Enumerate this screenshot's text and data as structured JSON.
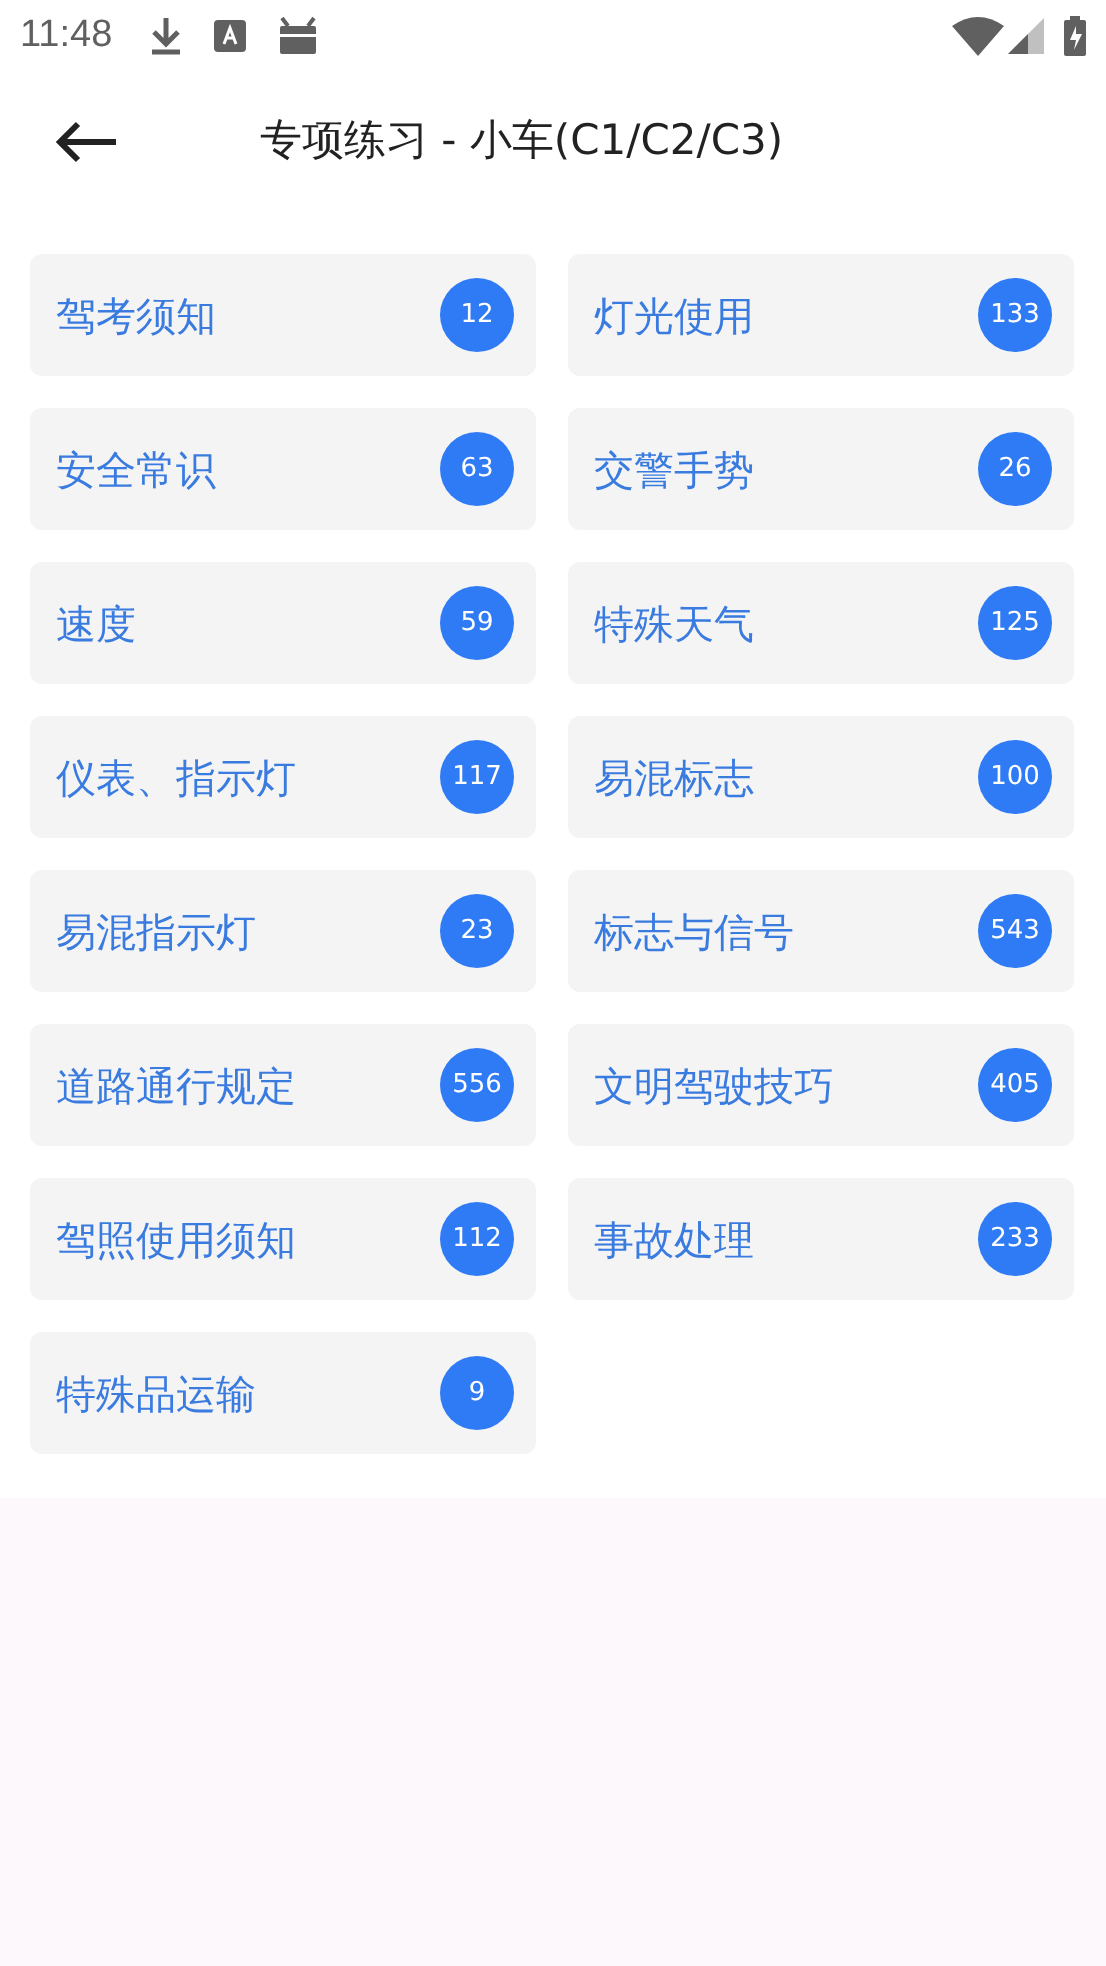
{
  "status_bar": {
    "time": "11:48"
  },
  "header": {
    "title": "专项练习 - 小车(C1/C2/C3)"
  },
  "categories": [
    {
      "label": "驾考须知",
      "count": "12"
    },
    {
      "label": "灯光使用",
      "count": "133"
    },
    {
      "label": "安全常识",
      "count": "63"
    },
    {
      "label": "交警手势",
      "count": "26"
    },
    {
      "label": "速度",
      "count": "59"
    },
    {
      "label": "特殊天气",
      "count": "125"
    },
    {
      "label": "仪表、指示灯",
      "count": "117"
    },
    {
      "label": "易混标志",
      "count": "100"
    },
    {
      "label": "易混指示灯",
      "count": "23"
    },
    {
      "label": "标志与信号",
      "count": "543"
    },
    {
      "label": "道路通行规定",
      "count": "556"
    },
    {
      "label": "文明驾驶技巧",
      "count": "405"
    },
    {
      "label": "驾照使用须知",
      "count": "112"
    },
    {
      "label": "事故处理",
      "count": "233"
    },
    {
      "label": "特殊品运输",
      "count": "9"
    }
  ]
}
